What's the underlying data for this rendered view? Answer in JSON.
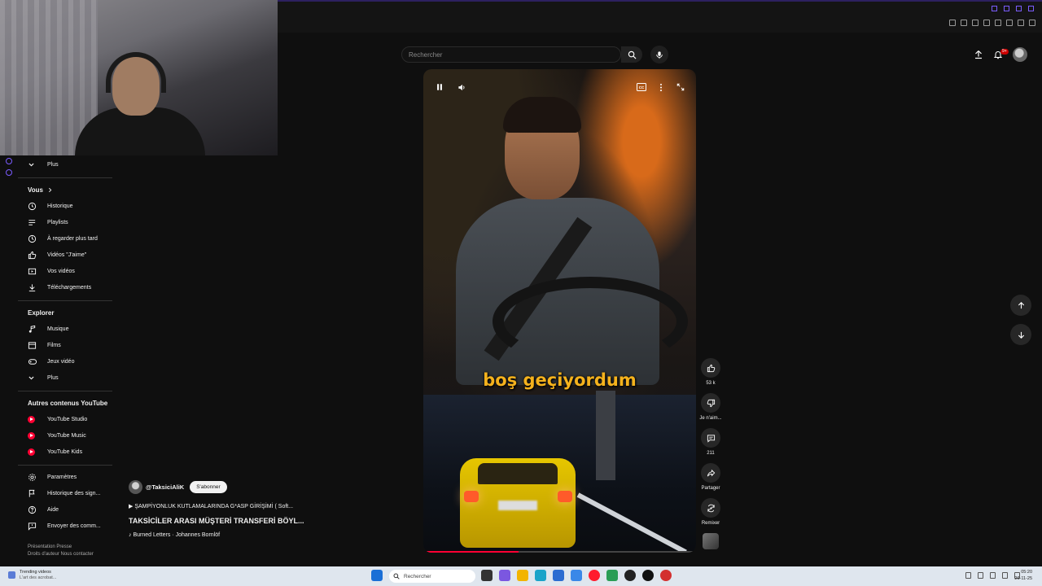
{
  "search": {
    "placeholder": "Rechercher"
  },
  "header": {
    "notification_badge": "9+"
  },
  "sidebar": {
    "more_top": "Plus",
    "you_section": "Vous",
    "you_items": [
      {
        "label": "Historique",
        "icon": "history-icon"
      },
      {
        "label": "Playlists",
        "icon": "playlist-icon"
      },
      {
        "label": "À regarder plus tard",
        "icon": "clock-icon"
      },
      {
        "label": "Vidéos \"J'aime\"",
        "icon": "thumbs-up-icon"
      },
      {
        "label": "Vos vidéos",
        "icon": "video-icon"
      },
      {
        "label": "Téléchargements",
        "icon": "download-icon"
      }
    ],
    "explore_section": "Explorer",
    "explore_items": [
      {
        "label": "Musique",
        "icon": "music-icon"
      },
      {
        "label": "Films",
        "icon": "film-icon"
      },
      {
        "label": "Jeux vidéo",
        "icon": "gamepad-icon"
      },
      {
        "label": "Plus",
        "icon": "chevron-down-icon"
      }
    ],
    "other_section": "Autres contenus YouTube",
    "other_items": [
      {
        "label": "YouTube Studio",
        "icon": "youtube-studio-icon"
      },
      {
        "label": "YouTube Music",
        "icon": "youtube-music-icon"
      },
      {
        "label": "YouTube Kids",
        "icon": "youtube-kids-icon"
      }
    ],
    "settings_items": [
      {
        "label": "Paramètres",
        "icon": "gear-icon"
      },
      {
        "label": "Historique des sign...",
        "icon": "flag-icon"
      },
      {
        "label": "Aide",
        "icon": "help-icon"
      },
      {
        "label": "Envoyer des comm...",
        "icon": "feedback-icon"
      }
    ],
    "footer_line1": "Présentation  Presse",
    "footer_line2": "Droits d'auteur  Nous contacter"
  },
  "video": {
    "caption": "boş geçiyordum",
    "progress": 0.35,
    "channel": "@TaksiciAliK",
    "subscribe_label": "S'abonner",
    "meta": "▶ ŞAMPİYONLUK KUTLAMALARINDA G*ASP GİRİŞİMİ ( Soft...",
    "title": "TAKSİCİLER ARASI MÜŞTERİ TRANSFERİ BÖYL...",
    "music": "♪ Burned Letters · Johannes Bornlöf"
  },
  "actions": {
    "likes": "53 k",
    "dislike": "Je n'aim...",
    "comments": "211",
    "share": "Partager",
    "remix": "Remixer"
  },
  "taskbar": {
    "widget_title": "Trending videos",
    "widget_sub": "L'art des acrobat...",
    "search_placeholder": "Rechercher",
    "time": "05:20",
    "date": "26-11-25"
  },
  "colors": {
    "accent": "#ff0033",
    "caption": "#f5b21d",
    "taxi": "#e6c600"
  }
}
